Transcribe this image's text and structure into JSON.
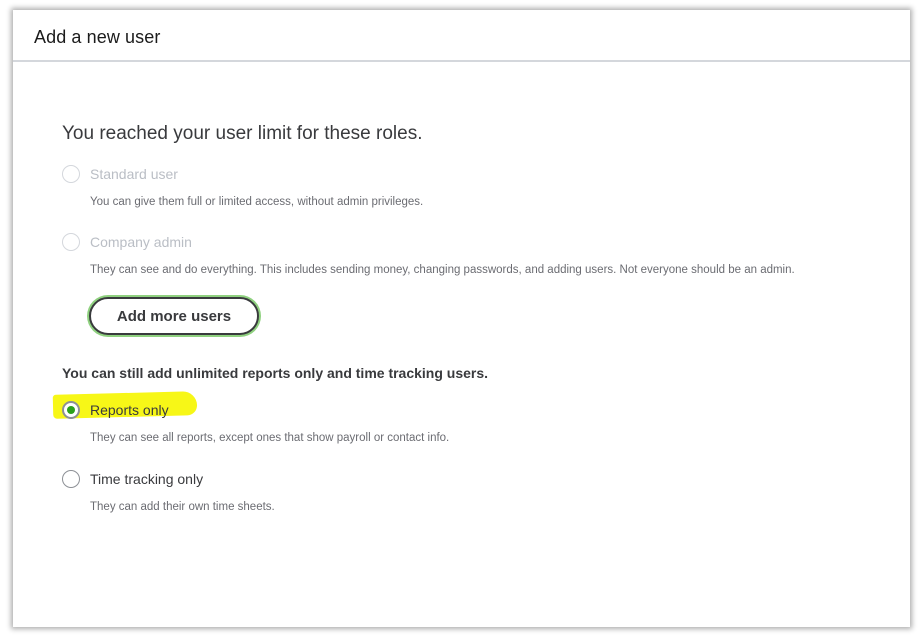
{
  "dialog": {
    "title": "Add a new user"
  },
  "limit_section": {
    "title": "You reached your user limit for these roles.",
    "options": [
      {
        "label": "Standard user",
        "description": "You can give them full or limited access, without admin privileges.",
        "disabled": true,
        "selected": false
      },
      {
        "label": "Company admin",
        "description": "They can see and do everything. This includes sending money, changing passwords, and adding users. Not everyone should be an admin.",
        "disabled": true,
        "selected": false
      }
    ],
    "add_more_label": "Add more users"
  },
  "unlimited_section": {
    "heading": "You can still add unlimited reports only and time tracking users.",
    "options": [
      {
        "label": "Reports only",
        "description": "They can see all reports, except ones that show payroll or contact info.",
        "disabled": false,
        "selected": true
      },
      {
        "label": "Time tracking only",
        "description": "They can add their own time sheets.",
        "disabled": false,
        "selected": false
      }
    ]
  },
  "colors": {
    "radio_selected_fill": "#2ca01c",
    "highlight": "#f7f717",
    "button_focus_ring": "#8fd17f"
  }
}
